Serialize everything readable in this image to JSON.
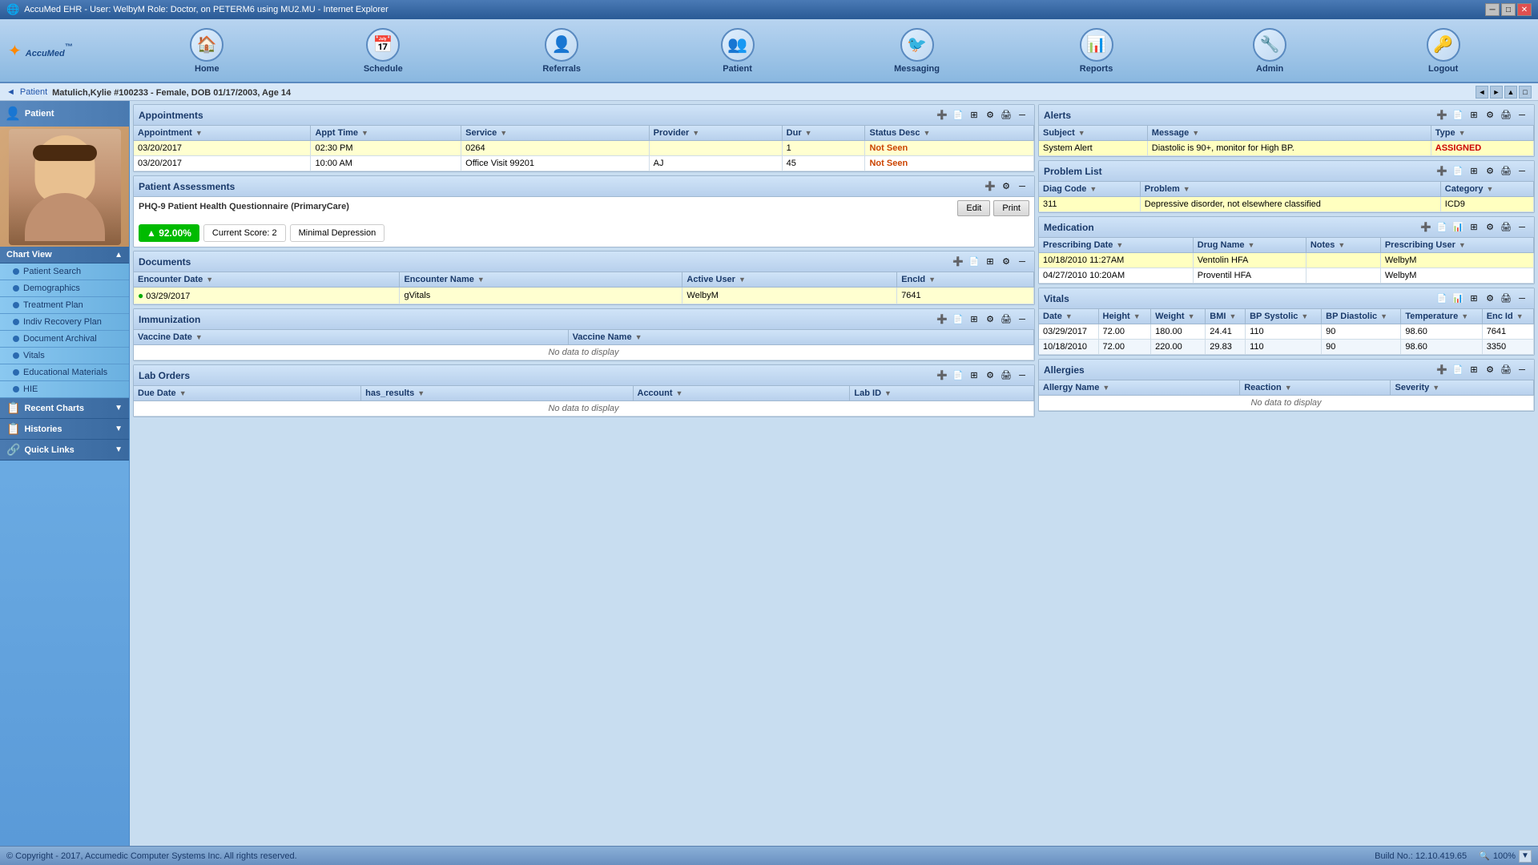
{
  "window": {
    "title": "AccuMed EHR - User: WelbyM Role: Doctor, on PETERM6 using MU2.MU - Internet Explorer"
  },
  "nav": {
    "logo": "AccuMed",
    "logo_tm": "™",
    "items": [
      {
        "label": "Home",
        "icon": "🏠"
      },
      {
        "label": "Schedule",
        "icon": "📅"
      },
      {
        "label": "Referrals",
        "icon": "👤"
      },
      {
        "label": "Patient",
        "icon": "👥"
      },
      {
        "label": "Messaging",
        "icon": "🐦"
      },
      {
        "label": "Reports",
        "icon": "📊"
      },
      {
        "label": "Admin",
        "icon": "🔧"
      },
      {
        "label": "Logout",
        "icon": "🔑"
      }
    ]
  },
  "breadcrumb": {
    "back_arrow": "◄",
    "patient_link": "Patient",
    "separator": " > "
  },
  "patient_header": {
    "name": "Matulich,Kylie #100233",
    "details": "Female, DOB 01/17/2003, Age 14"
  },
  "sidebar": {
    "patient_label": "Patient",
    "chart_view_label": "Chart View",
    "items": [
      {
        "label": "Patient Search",
        "id": "patient-search"
      },
      {
        "label": "Demographics",
        "id": "demographics"
      },
      {
        "label": "Treatment Plan",
        "id": "treatment-plan"
      },
      {
        "label": "Indiv Recovery Plan",
        "id": "indiv-recovery-plan"
      },
      {
        "label": "Document Archival",
        "id": "document-archival"
      },
      {
        "label": "Vitals",
        "id": "vitals"
      },
      {
        "label": "Educational Materials",
        "id": "educational-materials"
      },
      {
        "label": "HIE",
        "id": "hie"
      }
    ],
    "recent_charts_label": "Recent Charts",
    "histories_label": "Histories",
    "quick_links_label": "Quick Links"
  },
  "appointments": {
    "title": "Appointments",
    "columns": [
      "Appointment",
      "Appt Time",
      "Service",
      "Provider",
      "Dur",
      "Status Desc"
    ],
    "rows": [
      {
        "appointment": "03/20/2017",
        "appt_time": "02:30 PM",
        "service": "0264",
        "provider": "",
        "dur": "1",
        "status": "Not Seen",
        "highlight": true
      },
      {
        "appointment": "03/20/2017",
        "appt_time": "10:00 AM",
        "service": "Office Visit 99201",
        "provider": "AJ",
        "dur": "45",
        "status": "Not Seen",
        "highlight": false
      }
    ]
  },
  "patient_assessments": {
    "title": "Patient Assessments",
    "phq_label": "PHQ-9 Patient Health Questionnaire (PrimaryCare)",
    "edit_btn": "Edit",
    "print_btn": "Print",
    "score_pct": "▲ 92.00%",
    "current_score_label": "Current Score: 2",
    "depression_level": "Minimal Depression"
  },
  "documents": {
    "title": "Documents",
    "columns": [
      "Encounter Date",
      "Encounter Name",
      "Active User",
      "EncId"
    ],
    "rows": [
      {
        "date": "03/29/2017",
        "name": "gVitals",
        "user": "WelbyM",
        "enc_id": "7641",
        "has_green_dot": true
      }
    ]
  },
  "immunization": {
    "title": "Immunization",
    "columns": [
      "Vaccine Date",
      "Vaccine Name"
    ],
    "no_data": "No data to display"
  },
  "lab_orders": {
    "title": "Lab Orders",
    "columns": [
      "Due Date",
      "has_results",
      "Account",
      "Lab ID"
    ],
    "no_data": "No data to display"
  },
  "alerts": {
    "title": "Alerts",
    "columns": [
      "Subject",
      "Message",
      "Type"
    ],
    "rows": [
      {
        "subject": "System Alert",
        "message": "Diastolic is 90+, monitor for High BP.",
        "type": "ASSIGNED",
        "highlight": true
      }
    ]
  },
  "problem_list": {
    "title": "Problem List",
    "columns": [
      "Diag Code",
      "Problem",
      "Category"
    ],
    "rows": [
      {
        "diag_code": "311",
        "problem": "Depressive disorder, not elsewhere classified",
        "category": "ICD9",
        "highlight": true
      }
    ]
  },
  "medication": {
    "title": "Medication",
    "columns": [
      "Prescribing Date",
      "Drug Name",
      "Notes",
      "Prescribing User"
    ],
    "rows": [
      {
        "date": "10/18/2010 11:27AM",
        "drug": "Ventolin HFA",
        "notes": "",
        "user": "WelbyM",
        "highlight": true
      },
      {
        "date": "04/27/2010 10:20AM",
        "drug": "Proventil HFA",
        "notes": "",
        "user": "WelbyM",
        "highlight": false
      }
    ]
  },
  "vitals": {
    "title": "Vitals",
    "columns": [
      "Date",
      "Height",
      "Weight",
      "BMI",
      "BP Systolic",
      "BP Diastolic",
      "Temperature",
      "Enc Id"
    ],
    "rows": [
      {
        "date": "03/29/2017",
        "height": "72.00",
        "weight": "180.00",
        "bmi": "24.41",
        "bp_sys": "110",
        "bp_dia": "90",
        "temp": "98.60",
        "enc_id": "7641"
      },
      {
        "date": "10/18/2010",
        "height": "72.00",
        "weight": "220.00",
        "bmi": "29.83",
        "bp_sys": "110",
        "bp_dia": "90",
        "temp": "98.60",
        "enc_id": "3350"
      }
    ]
  },
  "allergies": {
    "title": "Allergies",
    "columns": [
      "Allergy Name",
      "Reaction",
      "Severity"
    ],
    "no_data": "No data to display"
  },
  "footer": {
    "copyright": "© Copyright - 2017, Accumedic Computer Systems Inc. All rights reserved.",
    "build": "Build No.: 12.10.419.65",
    "zoom": "100%"
  }
}
